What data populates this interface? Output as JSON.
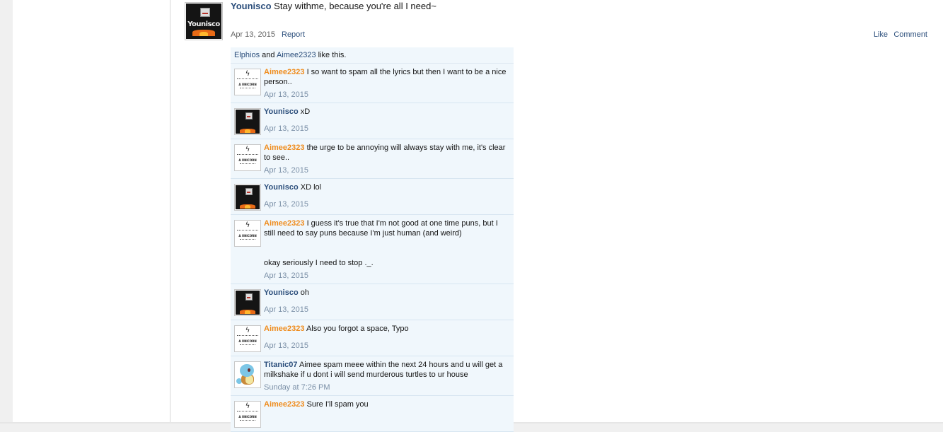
{
  "post": {
    "username": "Younisco",
    "message": "Stay withme, because you're all I need~",
    "date": "Apr 13, 2015",
    "report_label": "Report",
    "like_label": "Like",
    "comment_label": "Comment",
    "avatar_text": "Younisco"
  },
  "likes": {
    "user1": "Elphios",
    "and": "and",
    "user2": "Aimee2323",
    "suffix": "like this."
  },
  "comments": [
    {
      "user": "Aimee2323",
      "text": "I so want to spam all the lyrics but then I want to be a nice person..",
      "date": "Apr 13, 2015"
    },
    {
      "user": "Younisco",
      "text": "xD",
      "date": "Apr 13, 2015"
    },
    {
      "user": "Aimee2323",
      "text": "the urge to be annoying will always stay with me, it's clear to see..",
      "date": "Apr 13, 2015"
    },
    {
      "user": "Younisco",
      "text": "XD lol",
      "date": "Apr 13, 2015"
    },
    {
      "user": "Aimee2323",
      "text": "I guess it's true that I'm not good at one time puns, but I still need to say puns because I'm just human (and weird)",
      "extra": "okay seriously I need to stop ._.",
      "date": "Apr 13, 2015"
    },
    {
      "user": "Younisco",
      "text": "oh",
      "date": "Apr 13, 2015"
    },
    {
      "user": "Aimee2323",
      "text": "Also you forgot a space, Typo",
      "date": "Apr 13, 2015"
    },
    {
      "user": "Titanic07",
      "text": "Aimee spam meee within the next 24 hours and u will get a milkshake if u dont i will send murderous turtles to ur house",
      "date": "Sunday at 7:26 PM"
    },
    {
      "user": "Aimee2323",
      "text": "Sure I'll spam you",
      "date": ""
    }
  ],
  "colors": {
    "link": "#2b4e7b",
    "aimee_name": "#ef8c1d",
    "comment_bg": "#f0f7fc",
    "date_gray": "#7a8fa6"
  },
  "icons": {
    "younisco_avatar": "minecraft-character-fire-icon",
    "aimee_avatar": "unicorn-text-bolt-icon",
    "titanic_avatar": "squirtle-turtle-icon"
  }
}
